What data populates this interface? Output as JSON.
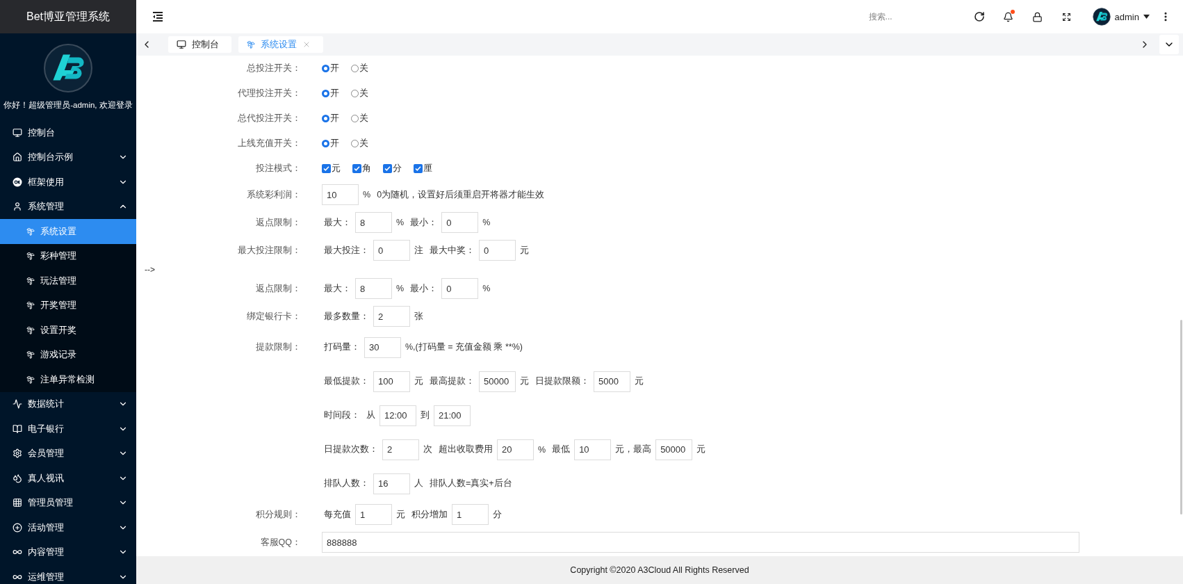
{
  "sidebar": {
    "title": "Bet博亚管理系统",
    "greeting": "你好！超级管理员-admin, 欢迎登录",
    "items": [
      {
        "label": "控制台"
      },
      {
        "label": "控制台示例",
        "expanded": false
      },
      {
        "label": "框架使用",
        "expanded": false
      },
      {
        "label": "系统管理",
        "expanded": true,
        "children": [
          {
            "label": "系统设置",
            "selected": true
          },
          {
            "label": "彩种管理",
            "selected": false
          },
          {
            "label": "玩法管理",
            "selected": false
          },
          {
            "label": "开奖管理",
            "selected": false
          },
          {
            "label": "设置开奖",
            "selected": false
          },
          {
            "label": "游戏记录",
            "selected": false
          },
          {
            "label": "注单异常检测",
            "selected": false
          }
        ]
      },
      {
        "label": "数据统计",
        "expanded": false
      },
      {
        "label": "电子银行",
        "expanded": false
      },
      {
        "label": "会员管理",
        "expanded": false
      },
      {
        "label": "真人视讯",
        "expanded": false
      },
      {
        "label": "管理员管理",
        "expanded": false
      },
      {
        "label": "活动管理",
        "expanded": false
      },
      {
        "label": "内容管理",
        "expanded": false
      },
      {
        "label": "运维管理",
        "expanded": false
      }
    ]
  },
  "header": {
    "search": {
      "placeholder": "搜索..."
    },
    "notifications": {
      "unread": true
    },
    "user": "admin"
  },
  "tabs": [
    {
      "label": "控制台",
      "selected": false,
      "closable": false
    },
    {
      "label": "系统设置",
      "selected": true,
      "closable": true
    }
  ],
  "form": [
    {
      "kind": "field",
      "label": "总投注开关：",
      "lines": [
        [
          {
            "kind": "radio",
            "label": "开",
            "selected": true
          },
          {
            "kind": "radio",
            "label": "关",
            "selected": false
          }
        ]
      ]
    },
    {
      "kind": "field",
      "label": "代理投注开关：",
      "lines": [
        [
          {
            "kind": "radio",
            "label": "开",
            "selected": true
          },
          {
            "kind": "radio",
            "label": "关",
            "selected": false
          }
        ]
      ]
    },
    {
      "kind": "field",
      "label": "总代投注开关：",
      "lines": [
        [
          {
            "kind": "radio",
            "label": "开",
            "selected": true
          },
          {
            "kind": "radio",
            "label": "关",
            "selected": false
          }
        ]
      ]
    },
    {
      "kind": "field",
      "label": "上线充值开关：",
      "lines": [
        [
          {
            "kind": "radio",
            "label": "开",
            "selected": true
          },
          {
            "kind": "radio",
            "label": "关",
            "selected": false
          }
        ]
      ]
    },
    {
      "kind": "field",
      "label": "投注模式：",
      "lines": [
        [
          {
            "kind": "checkbox",
            "label": "元",
            "checked": true
          },
          {
            "kind": "checkbox",
            "label": "角",
            "checked": true
          },
          {
            "kind": "checkbox",
            "label": "分",
            "checked": true
          },
          {
            "kind": "checkbox",
            "label": "厘",
            "checked": true
          }
        ]
      ]
    },
    {
      "kind": "field",
      "label": "系统彩利润：",
      "lines": [
        [
          {
            "kind": "input",
            "value": "10"
          },
          {
            "kind": "text",
            "text": "%"
          },
          {
            "kind": "text",
            "text": "0为随机，设置好后须重启开将器才能生效"
          }
        ]
      ]
    },
    {
      "kind": "field",
      "label": "返点限制：",
      "lines": [
        [
          {
            "kind": "text",
            "text": "最大："
          },
          {
            "kind": "input",
            "value": "8"
          },
          {
            "kind": "text",
            "text": "%"
          },
          {
            "kind": "text",
            "text": "最小："
          },
          {
            "kind": "input",
            "value": "0"
          },
          {
            "kind": "text",
            "text": "%"
          }
        ]
      ]
    },
    {
      "kind": "field",
      "label": "最大投注限制：",
      "lines": [
        [
          {
            "kind": "text",
            "text": "最大投注："
          },
          {
            "kind": "input",
            "value": "0"
          },
          {
            "kind": "text",
            "text": "注"
          },
          {
            "kind": "text",
            "text": "最大中奖："
          },
          {
            "kind": "input",
            "value": "0"
          },
          {
            "kind": "text",
            "text": "元"
          }
        ]
      ]
    },
    {
      "kind": "comment",
      "text": "-->"
    },
    {
      "kind": "field",
      "label": "返点限制：",
      "lines": [
        [
          {
            "kind": "text",
            "text": "最大："
          },
          {
            "kind": "input",
            "value": "8"
          },
          {
            "kind": "text",
            "text": "%"
          },
          {
            "kind": "text",
            "text": "最小："
          },
          {
            "kind": "input",
            "value": "0"
          },
          {
            "kind": "text",
            "text": "%"
          }
        ]
      ]
    },
    {
      "kind": "field",
      "label": "绑定银行卡：",
      "lines": [
        [
          {
            "kind": "text",
            "text": "最多数量："
          },
          {
            "kind": "input",
            "value": "2"
          },
          {
            "kind": "text",
            "text": "张"
          }
        ]
      ]
    },
    {
      "kind": "field",
      "label": "提款限制：",
      "lines": [
        [
          {
            "kind": "text",
            "text": "打码量："
          },
          {
            "kind": "input",
            "value": "30"
          },
          {
            "kind": "text",
            "text": "%,(打码量 = 充值金额 乘 **%)"
          }
        ],
        [
          {
            "kind": "text",
            "text": "最低提款："
          },
          {
            "kind": "input",
            "value": "100"
          },
          {
            "kind": "text",
            "text": "元"
          },
          {
            "kind": "text",
            "text": "最高提款："
          },
          {
            "kind": "input",
            "value": "50000"
          },
          {
            "kind": "text",
            "text": "元"
          },
          {
            "kind": "text",
            "text": "日提款限额："
          },
          {
            "kind": "input",
            "value": "5000"
          },
          {
            "kind": "text",
            "text": "元"
          }
        ],
        [
          {
            "kind": "text",
            "text": "时间段："
          },
          {
            "kind": "text",
            "text": "从"
          },
          {
            "kind": "input",
            "value": "12:00"
          },
          {
            "kind": "text",
            "text": "到"
          },
          {
            "kind": "input",
            "value": "21:00"
          }
        ],
        [
          {
            "kind": "text",
            "text": "日提款次数："
          },
          {
            "kind": "input",
            "value": "2"
          },
          {
            "kind": "text",
            "text": "次"
          },
          {
            "kind": "text",
            "text": "超出收取费用"
          },
          {
            "kind": "input",
            "value": "20"
          },
          {
            "kind": "text",
            "text": "%"
          },
          {
            "kind": "text",
            "text": "最低"
          },
          {
            "kind": "input",
            "value": "10"
          },
          {
            "kind": "text",
            "text": "元，最高"
          },
          {
            "kind": "input",
            "value": "50000"
          },
          {
            "kind": "text",
            "text": "元"
          }
        ],
        [
          {
            "kind": "text",
            "text": "排队人数："
          },
          {
            "kind": "input",
            "value": "16"
          },
          {
            "kind": "text",
            "text": "人"
          },
          {
            "kind": "text",
            "text": "排队人数=真实+后台"
          }
        ]
      ]
    },
    {
      "kind": "field",
      "label": "积分规则：",
      "lines": [
        [
          {
            "kind": "text",
            "text": "每充值"
          },
          {
            "kind": "input",
            "value": "1"
          },
          {
            "kind": "text",
            "text": "元"
          },
          {
            "kind": "text",
            "text": "积分增加"
          },
          {
            "kind": "input",
            "value": "1"
          },
          {
            "kind": "text",
            "text": "分"
          }
        ]
      ]
    },
    {
      "kind": "field",
      "label": "客服QQ：",
      "lines": [
        [
          {
            "kind": "longinput",
            "value": "888888"
          }
        ]
      ]
    }
  ],
  "footer": "Copyright ©2020 A3Cloud All Rights Reserved"
}
